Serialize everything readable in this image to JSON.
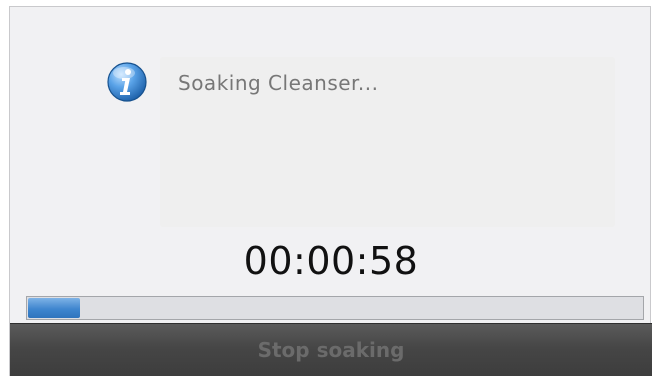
{
  "message": {
    "icon": "info-icon",
    "text": "Soaking Cleanser..."
  },
  "timer": {
    "value": "00:00:58"
  },
  "progress": {
    "fraction": 0.085
  },
  "actions": {
    "stop_label": "Stop soaking"
  },
  "colors": {
    "progress_fill": "#3f86cf",
    "action_bar": "#464646",
    "disabled_text": "#6b6b6b"
  }
}
